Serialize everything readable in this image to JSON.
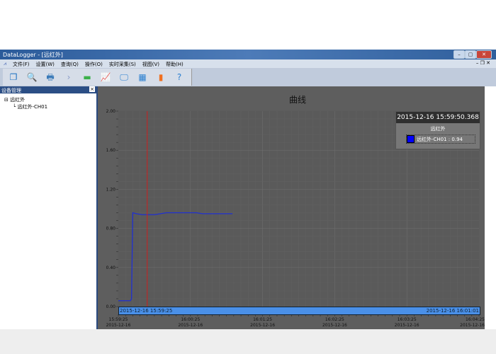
{
  "window": {
    "title": "DataLogger - [远红外]",
    "controls": [
      "–",
      "▢",
      "✕"
    ],
    "mdi_controls": [
      "–",
      "❐",
      "✕"
    ]
  },
  "menu": [
    "文件(F)",
    "设置(W)",
    "查询(Q)",
    "操作(O)",
    "实时采集(S)",
    "视图(V)",
    "帮助(H)"
  ],
  "toolbar": [
    {
      "icon": "window-icon",
      "glyph": "❐",
      "color": "#1a6fc0"
    },
    {
      "icon": "search-icon",
      "glyph": "🔍",
      "color": "#2a7fd0"
    },
    {
      "icon": "print-icon",
      "glyph": "🖶",
      "color": "#3a7ab8"
    },
    {
      "icon": "play-icon",
      "glyph": "›",
      "color": "#8a9bc8"
    },
    {
      "icon": "stop-icon",
      "glyph": "▬",
      "color": "#3bb04a"
    },
    {
      "icon": "line-chart-icon",
      "glyph": "📈",
      "color": "#444"
    },
    {
      "icon": "monitor-icon",
      "glyph": "🖵",
      "color": "#2a7fd0"
    },
    {
      "icon": "table-icon",
      "glyph": "▦",
      "color": "#2a7fd0"
    },
    {
      "icon": "bar-chart-icon",
      "glyph": "▮",
      "color": "#f07020"
    },
    {
      "icon": "help-icon",
      "glyph": "?",
      "color": "#2a7fd0"
    }
  ],
  "sidebar": {
    "title": "设备管理",
    "close": "×",
    "tree": {
      "root": "远红外",
      "child": "远红外-CH01"
    }
  },
  "chart_data": {
    "type": "line",
    "title": "曲线",
    "ylim": [
      0,
      2.0
    ],
    "yticks": [
      "0.00",
      "0.40",
      "0.80",
      "1.20",
      "1.60",
      "2.00"
    ],
    "xlim": [
      "15:59:25",
      "16:04:25"
    ],
    "xticks": [
      {
        "time": "15:59:25",
        "date": "2015-12-16"
      },
      {
        "time": "16:00:25",
        "date": "2015-12-16"
      },
      {
        "time": "16:01:25",
        "date": "2015-12-16"
      },
      {
        "time": "16:02:25",
        "date": "2015-12-16"
      },
      {
        "time": "16:03:25",
        "date": "2015-12-16"
      },
      {
        "time": "16:04:25",
        "date": "2015-12-16"
      }
    ],
    "series": [
      {
        "name": "远红外-CH01",
        "color": "#2030d0",
        "points": [
          [
            "15:59:25",
            0.06
          ],
          [
            "15:59:35",
            0.06
          ],
          [
            "15:59:36",
            0.08
          ],
          [
            "15:59:37",
            0.96
          ],
          [
            "15:59:40",
            0.95
          ],
          [
            "15:59:45",
            0.94
          ],
          [
            "15:59:55",
            0.94
          ],
          [
            "16:00:00",
            0.95
          ],
          [
            "16:00:05",
            0.96
          ],
          [
            "16:00:30",
            0.96
          ],
          [
            "16:00:35",
            0.95
          ],
          [
            "16:01:00",
            0.95
          ]
        ]
      }
    ],
    "cursor": {
      "time": "15:59:49",
      "color": "#cc2020"
    },
    "legend": {
      "timestamp": "2015-12-16 15:59:50.368",
      "group": "远红外",
      "entry": "远红外-CH01 : 0.94",
      "swatch": "#0000ff"
    },
    "range_bar": {
      "start": "2015-12-16 15:59:25",
      "end": "2015-12-16 16:01:01",
      "color": "#4a90e8"
    }
  }
}
